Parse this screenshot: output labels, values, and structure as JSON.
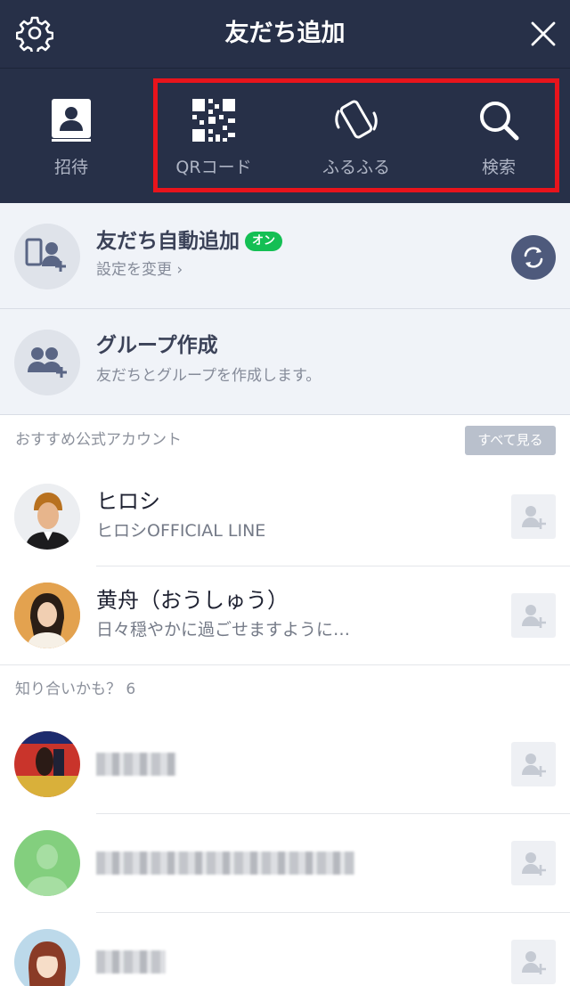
{
  "header": {
    "title": "友だち追加",
    "settings_icon": "gear-icon",
    "close_icon": "close-icon"
  },
  "add_methods": [
    {
      "label": "招待",
      "icon": "contact-book-icon"
    },
    {
      "label": "QRコード",
      "icon": "qr-code-icon"
    },
    {
      "label": "ふるふる",
      "icon": "shake-phone-icon"
    },
    {
      "label": "検索",
      "icon": "search-icon"
    }
  ],
  "highlight_color": "#e8141c",
  "auto_add": {
    "title": "友だち自動追加",
    "badge": "オン",
    "subtitle": "設定を変更 ›"
  },
  "create_group": {
    "title": "グループ作成",
    "subtitle": "友だちとグループを作成します。"
  },
  "recommended": {
    "title": "おすすめ公式アカウント",
    "see_all": "すべて見る",
    "items": [
      {
        "name": "ヒロシ",
        "desc": "ヒロシOFFICIAL LINE"
      },
      {
        "name": "黄舟（おうしゅう）",
        "desc": "日々穏やかに過ごせますように…"
      }
    ]
  },
  "suggestions": {
    "title": "知り合いかも？ 6"
  },
  "colors": {
    "header_bg": "#273048",
    "badge_green": "#14bf54",
    "accent_blue": "#4e5a7c"
  }
}
